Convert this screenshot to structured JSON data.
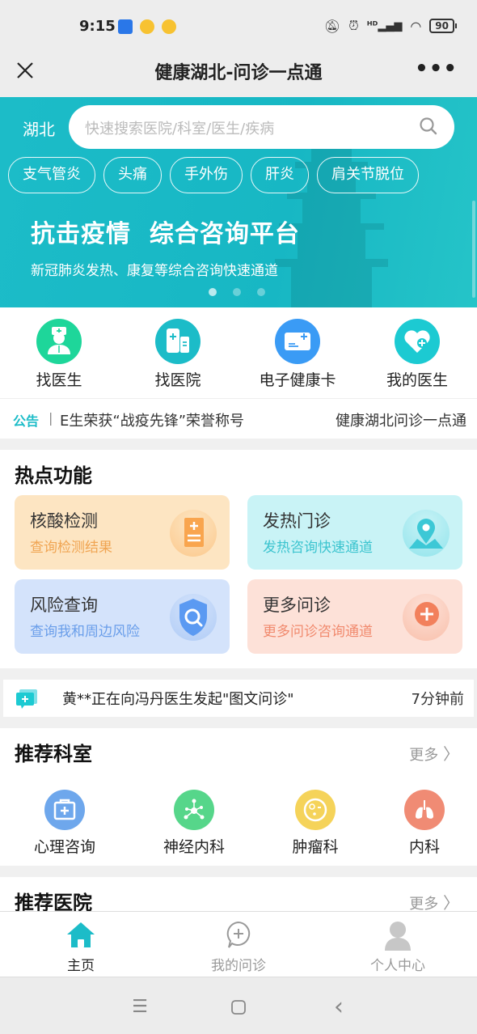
{
  "status_bar": {
    "time": "9:15",
    "battery": "90",
    "icons": [
      "alipay-app-icon",
      "weibo-app-icon",
      "weibo-app-icon",
      "mute-icon",
      "alarm-icon",
      "hd-signal-icon",
      "wifi-icon",
      "battery-icon"
    ]
  },
  "navbar": {
    "close_icon": "✕",
    "title": "健康湖北-问诊一点通",
    "more_icon": "•••"
  },
  "banner": {
    "region": "湖北",
    "search_placeholder": "快速搜索医院/科室/医生/疾病",
    "tags": [
      "支气管炎",
      "头痛",
      "手外伤",
      "肝炎",
      "肩关节脱位"
    ],
    "slogan": "抗击疫情  综合咨询平台",
    "subtitle": "新冠肺炎发热、康复等综合咨询快速通道",
    "carousel_pages": 3,
    "carousel_active": 1,
    "color": "#1cbcc8"
  },
  "quick_entries": [
    {
      "label": "找医生",
      "icon": "doctor-icon",
      "color": "#1ed69a"
    },
    {
      "label": "找医院",
      "icon": "hospital-icon",
      "color": "#1cbcc8"
    },
    {
      "label": "电子健康卡",
      "icon": "health-card-icon",
      "color": "#3a9bf5"
    },
    {
      "label": "我的医生",
      "icon": "heart-plus-icon",
      "color": "#1ccad2"
    }
  ],
  "notice": {
    "tag": "公告",
    "separator": "|",
    "items": [
      "医生荣获“战疫先锋”荣誉称号",
      "健康湖北问诊一点通"
    ],
    "visible_first": "⁠E生荣获“战疫先锋”荣誉称号"
  },
  "hot_functions": {
    "title": "热点功能",
    "cards": [
      {
        "title": "核酸检测",
        "subtitle": "查询检测结果",
        "icon": "test-report-icon",
        "bg": "#fde5c2",
        "sub_color": "#f0a553",
        "icon_color": "#f9a54e"
      },
      {
        "title": "发热门诊",
        "subtitle": "发热咨询快速通道",
        "icon": "location-pin-icon",
        "bg": "#c9f3f6",
        "sub_color": "#3cc4cf",
        "icon_color": "#3cc8d6"
      },
      {
        "title": "风险查询",
        "subtitle": "查询我和周边风险",
        "icon": "shield-search-icon",
        "bg": "#d4e3fb",
        "sub_color": "#6a9eea",
        "icon_color": "#5b9af2"
      },
      {
        "title": "更多问诊",
        "subtitle": "更多问诊咨询通道",
        "icon": "plus-bubble-icon",
        "bg": "#fde1d8",
        "sub_color": "#f18a6e",
        "icon_color": "#f2805c"
      }
    ]
  },
  "feed": {
    "text": "黄**正在向冯丹医生发起\"图文问诊\"",
    "time": "7分钟前"
  },
  "departments": {
    "title": "推荐科室",
    "more": "更多",
    "items": [
      {
        "label": "心理咨询",
        "icon": "first-aid-kit-icon",
        "color": "#6ea7ec"
      },
      {
        "label": "神经内科",
        "icon": "neuron-icon",
        "color": "#56d68a"
      },
      {
        "label": "肿瘤科",
        "icon": "cell-icon",
        "color": "#f5d35a"
      },
      {
        "label": "内科",
        "icon": "lungs-icon",
        "color": "#f08b74"
      }
    ]
  },
  "hospitals": {
    "title": "推荐医院",
    "more": "更多"
  },
  "tabbar": {
    "tabs": [
      {
        "label": "主页",
        "icon": "home-icon",
        "active": true
      },
      {
        "label": "我的问诊",
        "icon": "chat-plus-icon",
        "active": false
      },
      {
        "label": "个人中心",
        "icon": "user-icon",
        "active": false
      }
    ],
    "active_color": "#1cbcc8"
  },
  "system_nav": {
    "menu": "☰",
    "home": "▢",
    "back": "‹"
  }
}
